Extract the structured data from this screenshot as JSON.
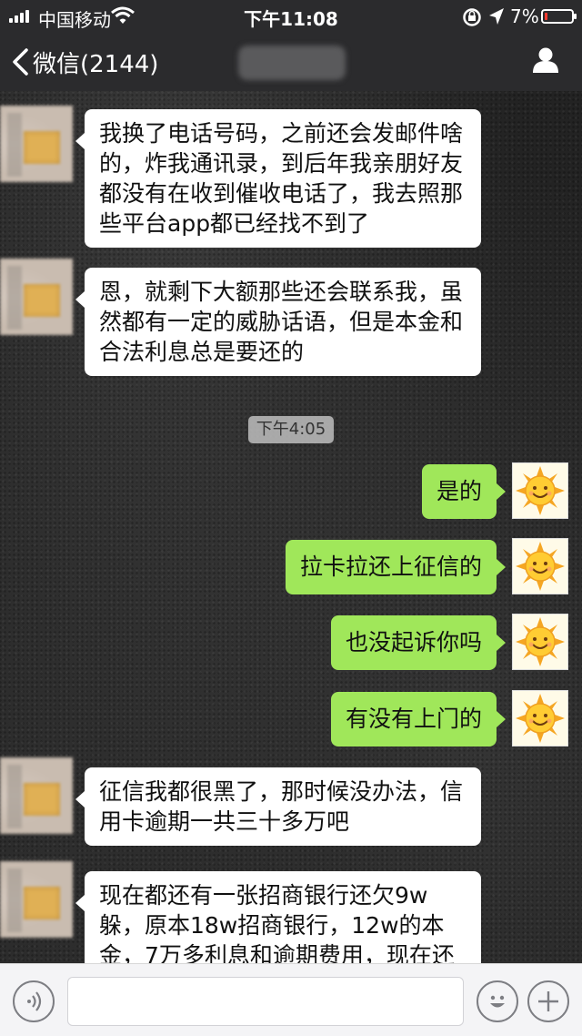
{
  "status_bar": {
    "carrier": "中国移动",
    "time": "下午11:08",
    "battery_percent": "7%",
    "battery_level": 0.07,
    "battery_color": "#ff3b30"
  },
  "nav": {
    "back_label": "微信(2144)",
    "title": "",
    "right_icon": "profile-icon"
  },
  "messages": [
    {
      "side": "left",
      "text": "我换了电话号码，之前还会发邮件啥的，炸我通讯录，到后年我亲朋好友都没有在收到催收电话了，我去照那些平台app都已经找不到了"
    },
    {
      "side": "left",
      "text": "恩，就剩下大额那些还会联系我，虽然都有一定的威胁话语，但是本金和合法利息总是要还的"
    },
    {
      "type": "time",
      "text": "下午4:05"
    },
    {
      "side": "right",
      "text": "是的"
    },
    {
      "side": "right",
      "text": "拉卡拉还上征信的"
    },
    {
      "side": "right",
      "text": "也没起诉你吗"
    },
    {
      "side": "right",
      "text": "有没有上门的"
    },
    {
      "side": "left",
      "text": "征信我都很黑了，那时候没办法，信用卡逾期一共三十多万吧"
    },
    {
      "side": "left",
      "text": "现在都还有一张招商银行还欠9w躲，原本18w招商银行，12w的本金，7万多利息和逾期费用，现在还"
    }
  ],
  "input_bar": {
    "placeholder": "",
    "left_icon": "voice-icon",
    "right_icons": [
      "emoji-icon",
      "plus-icon"
    ]
  },
  "colors": {
    "bar_bg": "#2b2b2d",
    "bubble_sent": "#a0e75a",
    "bubble_received": "#ffffff"
  }
}
